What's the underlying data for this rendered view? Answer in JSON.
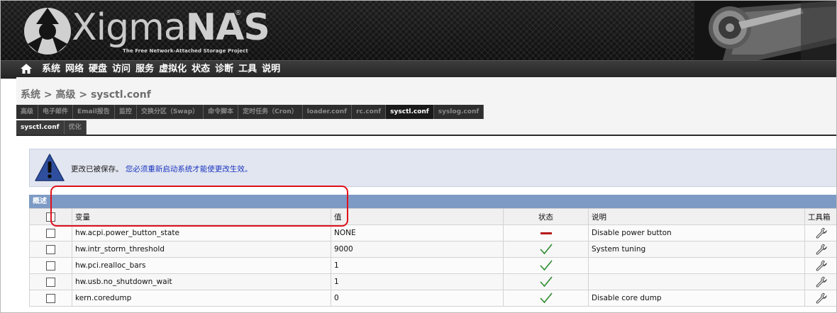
{
  "brand": {
    "name_part1": "Xigma",
    "name_part2": "NAS",
    "registered": "®",
    "tagline": "The Free Network-Attached Storage Project"
  },
  "nav": {
    "home_icon": "home-icon",
    "items": [
      "系统",
      "网络",
      "硬盘",
      "访问",
      "服务",
      "虚拟化",
      "状态",
      "诊断",
      "工具",
      "说明"
    ]
  },
  "breadcrumb": "系统 > 高级 > sysctl.conf",
  "tabs_row1": [
    {
      "label": "高级",
      "active": false
    },
    {
      "label": "电子邮件",
      "active": false
    },
    {
      "label": "Email报告",
      "active": false
    },
    {
      "label": "监控",
      "active": false
    },
    {
      "label": "交换分区（Swap）",
      "active": false
    },
    {
      "label": "命令脚本",
      "active": false
    },
    {
      "label": "定时任务（Cron）",
      "active": false
    },
    {
      "label": "loader.conf",
      "active": false
    },
    {
      "label": "rc.conf",
      "active": false
    },
    {
      "label": "sysctl.conf",
      "active": true
    },
    {
      "label": "syslog.conf",
      "active": false
    }
  ],
  "tabs_row2": [
    {
      "label": "sysctl.conf",
      "active": true
    },
    {
      "label": "优化",
      "active": false
    }
  ],
  "message": {
    "icon": "warning-icon",
    "part1": "更改已被保存。",
    "part2": "您必须重新启动系统才能使更改生效。"
  },
  "section": {
    "title": "概述",
    "columns": {
      "select": "",
      "variable": "变量",
      "value": "值",
      "status": "状态",
      "description": "说明",
      "toolbox": "工具箱"
    },
    "rows": [
      {
        "variable": "hw.acpi.power_button_state",
        "value": "NONE",
        "status": "disabled",
        "description": "Disable power button"
      },
      {
        "variable": "hw.intr_storm_threshold",
        "value": "9000",
        "status": "enabled",
        "description": "System tuning"
      },
      {
        "variable": "hw.pci.realloc_bars",
        "value": "1",
        "status": "enabled",
        "description": ""
      },
      {
        "variable": "hw.usb.no_shutdown_wait",
        "value": "1",
        "status": "enabled",
        "description": ""
      },
      {
        "variable": "kern.coredump",
        "value": "0",
        "status": "enabled",
        "description": "Disable core dump"
      }
    ]
  },
  "colors": {
    "status_enabled": "#2e8b2e",
    "status_disabled": "#b51a1a",
    "section_header": "#7d9ac4",
    "message_link": "#1a34c0",
    "highlight": "#e0101a"
  }
}
